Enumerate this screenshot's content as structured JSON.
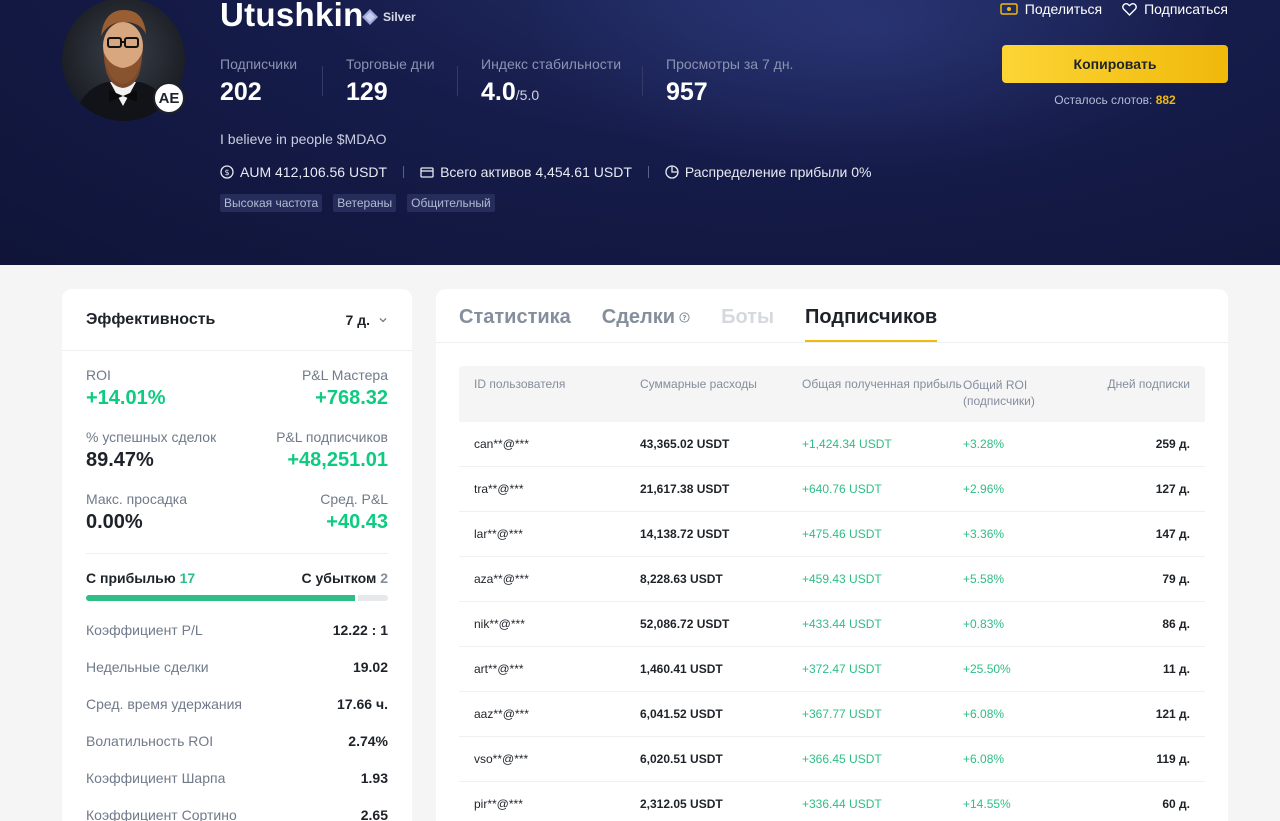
{
  "profile": {
    "name": "Utushkin",
    "tier": "Silver",
    "avatar_badge": "AE",
    "bio": "I believe in people $MDAO",
    "stats": [
      {
        "label": "Подписчики",
        "value": "202"
      },
      {
        "label": "Торговые дни",
        "value": "129"
      },
      {
        "label": "Индекс стабильности",
        "value": "4.0",
        "suffix": "/5.0"
      },
      {
        "label": "Просмотры за 7 дн.",
        "value": "957"
      }
    ],
    "aum": "AUM 412,106.56 USDT",
    "total_assets": "Всего активов 4,454.61 USDT",
    "profit_share": "Распределение прибыли 0%",
    "tags": [
      "Высокая частота",
      "Ветераны",
      "Общительный"
    ]
  },
  "actions": {
    "share": "Поделиться",
    "subscribe": "Подписаться",
    "copy": "Копировать",
    "slots_label": "Осталось слотов:",
    "slots_value": "882"
  },
  "performance": {
    "title": "Эффективность",
    "period": "7 д.",
    "kpis": [
      {
        "left_label": "ROI",
        "left_value": "+14.01%",
        "right_label": "P&L Мастера",
        "right_value": "+768.32"
      },
      {
        "left_label": "% успешных сделок",
        "left_value": "89.47%",
        "right_label": "P&L подписчиков",
        "right_value": "+48,251.01"
      },
      {
        "left_label": "Макс. просадка",
        "left_value": "0.00%",
        "right_label": "Сред. P&L",
        "right_value": "+40.43"
      }
    ],
    "wins_label": "С прибылью",
    "wins": "17",
    "losses_label": "С убытком",
    "losses": "2",
    "win_fraction": 0.8947,
    "metrics": [
      {
        "label": "Коэффициент P/L",
        "value": "12.22 : 1"
      },
      {
        "label": "Недельные сделки",
        "value": "19.02"
      },
      {
        "label": "Сред. время удержания",
        "value": "17.66 ч."
      },
      {
        "label": "Волатильность ROI",
        "value": "2.74%"
      },
      {
        "label": "Коэффициент Шарпа",
        "value": "1.93"
      },
      {
        "label": "Коэффициент Сортино",
        "value": "2.65"
      }
    ]
  },
  "tabs": [
    {
      "label": "Статистика",
      "state": "normal"
    },
    {
      "label": "Сделки",
      "state": "normal",
      "help": true
    },
    {
      "label": "Боты",
      "state": "disabled"
    },
    {
      "label": "Подписчиков",
      "state": "active"
    }
  ],
  "table": {
    "headers": [
      "ID пользователя",
      "Суммарные расходы",
      "Общая полученная прибыль",
      "Общий ROI (подписчики)",
      "Дней подписки"
    ],
    "rows": [
      [
        "can**@***",
        "43,365.02 USDT",
        "+1,424.34 USDT",
        "+3.28%",
        "259 д."
      ],
      [
        "tra**@***",
        "21,617.38 USDT",
        "+640.76 USDT",
        "+2.96%",
        "127 д."
      ],
      [
        "lar**@***",
        "14,138.72 USDT",
        "+475.46 USDT",
        "+3.36%",
        "147 д."
      ],
      [
        "aza**@***",
        "8,228.63 USDT",
        "+459.43 USDT",
        "+5.58%",
        "79 д."
      ],
      [
        "nik**@***",
        "52,086.72 USDT",
        "+433.44 USDT",
        "+0.83%",
        "86 д."
      ],
      [
        "art**@***",
        "1,460.41 USDT",
        "+372.47 USDT",
        "+25.50%",
        "11 д."
      ],
      [
        "aaz**@***",
        "6,041.52 USDT",
        "+367.77 USDT",
        "+6.08%",
        "121 д."
      ],
      [
        "vso**@***",
        "6,020.51 USDT",
        "+366.45 USDT",
        "+6.08%",
        "119 д."
      ],
      [
        "pir**@***",
        "2,312.05 USDT",
        "+336.44 USDT",
        "+14.55%",
        "60 д."
      ]
    ]
  }
}
